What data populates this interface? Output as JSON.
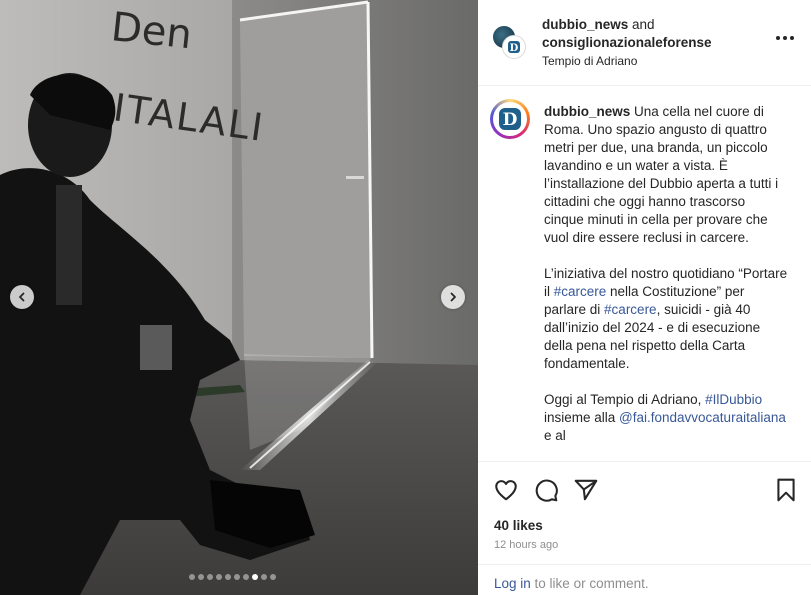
{
  "post": {
    "image_alt": "Man in dark suit sitting on a cot inside a grey concrete cell with graffiti on the wall",
    "graffiti_text": [
      "Den",
      "ITALALI"
    ],
    "carousel": {
      "total": 10,
      "active_index": 7
    }
  },
  "header": {
    "user1": "dubbio_news",
    "and_word": "and",
    "user2": "consiglionazionaleforense",
    "location": "Tempio di Adriano"
  },
  "caption": {
    "username": "dubbio_news",
    "p1": " Una cella nel cuore di Roma. Uno spazio angusto di quattro metri per due, una branda, un piccolo lavandino e un water a vista. È l’installazione del Dubbio aperta a tutti i cittadini che oggi hanno trascorso cinque minuti in cella per provare che vuol dire essere reclusi in carcere.",
    "p2a": "L’iniziativa del nostro quotidiano “Portare il ",
    "tag_carcere1": "#carcere",
    "p2b": " nella Costituzione” per parlare di ",
    "tag_carcere2": "#carcere",
    "p2c": ", suicidi - già 40 dall’inizio del 2024 - e di esecuzione della pena nel rispetto della Carta fondamentale.",
    "p3a": "Oggi al Tempio di Adriano, ",
    "tag_ildubbio": "#IlDubbio",
    "p3b": " insieme alla ",
    "mention": "@fai.fondavvocaturaitaliana",
    "p3c": " e al"
  },
  "stats": {
    "likes": "40 likes",
    "time": "12 hours ago"
  },
  "comment": {
    "login_label": "Log in",
    "rest": " to like or comment."
  },
  "icons": {
    "like": "heart-icon",
    "comment": "comment-icon",
    "share": "send-icon",
    "save": "bookmark-icon",
    "more": "more-horizontal-icon",
    "prev": "chevron-left-icon",
    "next": "chevron-right-icon"
  },
  "colors": {
    "link": "#385898",
    "muted": "#8e8e8e",
    "text": "#262626"
  }
}
